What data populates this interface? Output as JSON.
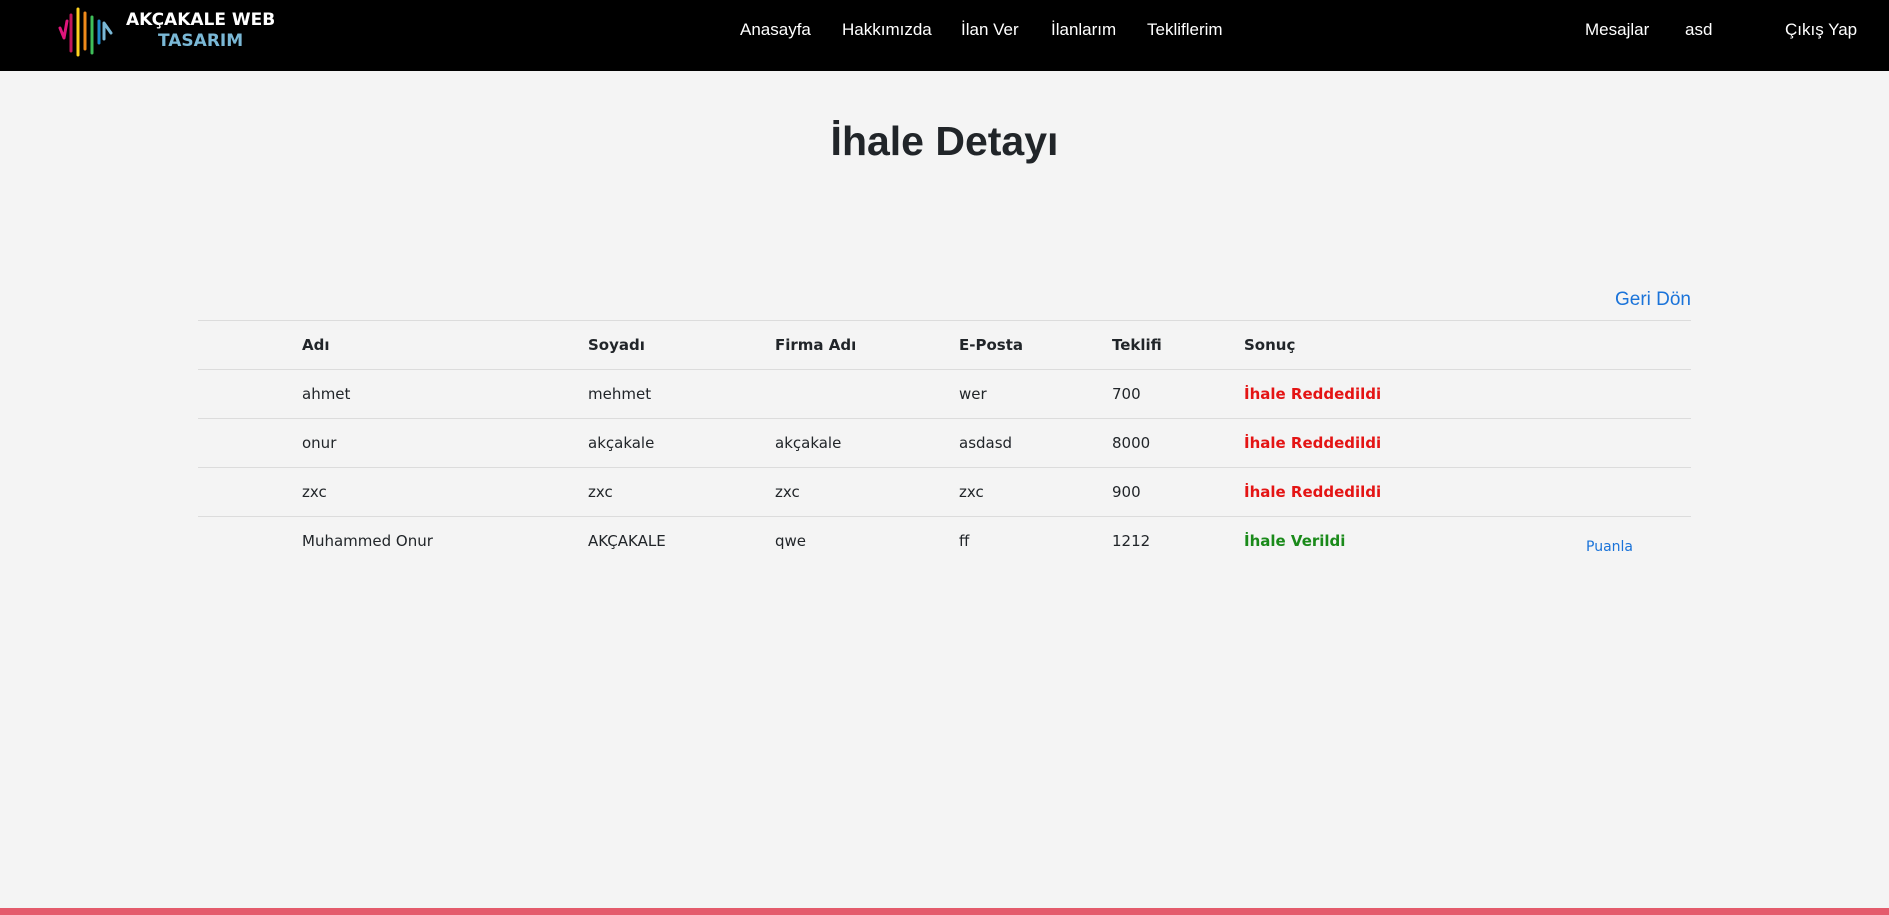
{
  "navbar": {
    "logo": {
      "line1": "AKÇAKALE WEB",
      "line2": "TASARIM",
      "bar_colors": [
        "#e0157c",
        "#c2185b",
        "#ffd21f",
        "#f08a1a",
        "#3fbf5a",
        "#1e88c9",
        "#7ab8d6"
      ]
    },
    "links": {
      "home": "Anasayfa",
      "about": "Hakkımızda",
      "post_ad": "İlan Ver",
      "my_ads": "İlanlarım",
      "my_offers": "Tekliflerim",
      "messages": "Mesajlar",
      "user": "asd",
      "logout": "Çıkış Yap"
    }
  },
  "page": {
    "title": "İhale Detayı",
    "back_label": "Geri Dön"
  },
  "table": {
    "headers": {
      "first_name": "Adı",
      "last_name": "Soyadı",
      "company": "Firma Adı",
      "email": "E-Posta",
      "offer": "Teklifi",
      "result": "Sonuç"
    },
    "rows": [
      {
        "first_name": "ahmet",
        "last_name": "mehmet",
        "company": "",
        "email": "wer",
        "offer": "700",
        "result": "İhale Reddedildi",
        "status": "rejected",
        "action": ""
      },
      {
        "first_name": "onur",
        "last_name": "akçakale",
        "company": "akçakale",
        "email": "asdasd",
        "offer": "8000",
        "result": "İhale Reddedildi",
        "status": "rejected",
        "action": ""
      },
      {
        "first_name": "zxc",
        "last_name": "zxc",
        "company": "zxc",
        "email": "zxc",
        "offer": "900",
        "result": "İhale Reddedildi",
        "status": "rejected",
        "action": ""
      },
      {
        "first_name": "Muhammed Onur",
        "last_name": "AKÇAKALE",
        "company": "qwe",
        "email": "ff",
        "offer": "1212",
        "result": "İhale Verildi",
        "status": "awarded",
        "action": "Puanla"
      }
    ]
  },
  "colors": {
    "navbar_bg": "#000000",
    "page_bg": "#f4f4f4",
    "link": "#1a73d9",
    "rejected": "#e41414",
    "awarded": "#1a8a1a",
    "footer_accent": "#e45b6c"
  }
}
